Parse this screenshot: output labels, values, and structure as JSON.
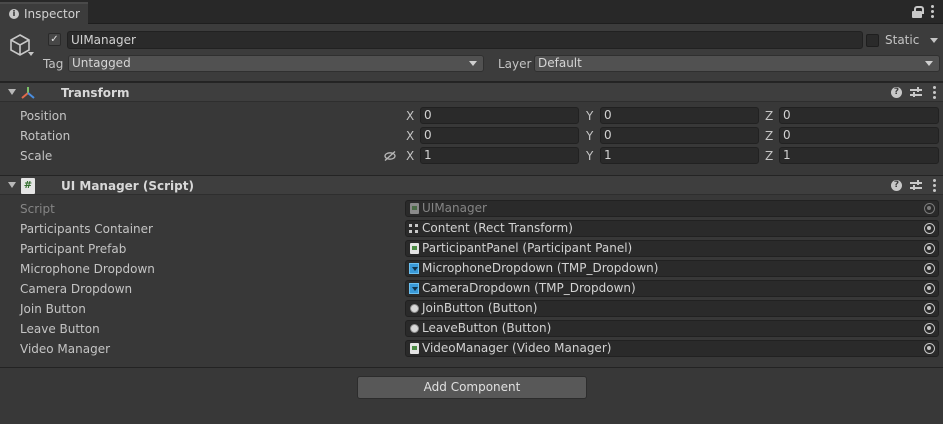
{
  "tab": {
    "title": "Inspector"
  },
  "gameobject": {
    "active": true,
    "name": "UIManager",
    "static_label": "Static",
    "static": false,
    "tag_label": "Tag",
    "tag_value": "Untagged",
    "layer_label": "Layer",
    "layer_value": "Default"
  },
  "transform": {
    "title": "Transform",
    "rows": [
      {
        "label": "Position",
        "x": "0",
        "y": "0",
        "z": "0"
      },
      {
        "label": "Rotation",
        "x": "0",
        "y": "0",
        "z": "0"
      },
      {
        "label": "Scale",
        "x": "1",
        "y": "1",
        "z": "1"
      }
    ],
    "axis_labels": [
      "X",
      "Y",
      "Z"
    ]
  },
  "script_component": {
    "title": "UI Manager (Script)",
    "fields": [
      {
        "label": "Script",
        "value": "UIManager",
        "icon": "script-asset-icon",
        "disabled": true
      },
      {
        "label": "Participants Container",
        "value": "Content (Rect Transform)",
        "icon": "rect-transform-icon"
      },
      {
        "label": "Participant Prefab",
        "value": "ParticipantPanel (Participant Panel)",
        "icon": "script-asset-icon"
      },
      {
        "label": "Microphone Dropdown",
        "value": "MicrophoneDropdown (TMP_Dropdown)",
        "icon": "dropdown-icon"
      },
      {
        "label": "Camera Dropdown",
        "value": "CameraDropdown (TMP_Dropdown)",
        "icon": "dropdown-icon"
      },
      {
        "label": "Join Button",
        "value": "JoinButton (Button)",
        "icon": "button-icon"
      },
      {
        "label": "Leave Button",
        "value": "LeaveButton (Button)",
        "icon": "button-icon"
      },
      {
        "label": "Video Manager",
        "value": "VideoManager (Video Manager)",
        "icon": "script-asset-icon"
      }
    ]
  },
  "add_component_label": "Add Component",
  "colors": {
    "background": "#383838",
    "field": "#2a2a2a",
    "header": "#3e3e3e",
    "dropdown_icon": "#3a9ad9"
  }
}
